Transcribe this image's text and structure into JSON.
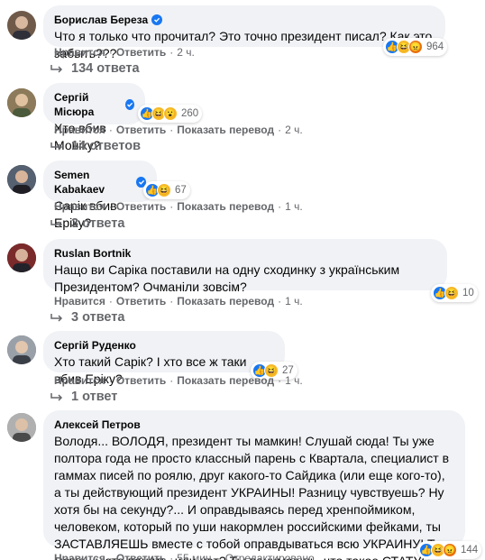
{
  "labels": {
    "like": "Нравится",
    "reply": "Ответить",
    "translate": "Показать перевод",
    "edited": "Отредактировано",
    "sep": "·"
  },
  "comments": [
    {
      "author": "Борислав Береза",
      "verified": true,
      "text": "Что я только что прочитал? Это точно президент писал? Как это забыть???",
      "reactions": [
        "like",
        "haha",
        "angry"
      ],
      "reaction_count": "964",
      "time": "2 ч.",
      "show_translate": false,
      "replies": "134 ответа",
      "avatar_color": "#6f5a4a"
    },
    {
      "author": "Сергій Місюра",
      "verified": true,
      "text": "Хто вбив Моніку?",
      "reactions": [
        "like",
        "haha",
        "wow"
      ],
      "reaction_count": "260",
      "time": "2 ч.",
      "show_translate": true,
      "replies": "14 ответов",
      "avatar_color": "#7a6a52"
    },
    {
      "author": "Semen Kabakaev",
      "verified": true,
      "text": "Сарік вбив Еріку?",
      "reactions": [
        "like",
        "haha"
      ],
      "reaction_count": "67",
      "time": "1 ч.",
      "show_translate": true,
      "replies": "3 ответа",
      "avatar_color": "#3b3f47"
    },
    {
      "author": "Ruslan Bortnik",
      "verified": false,
      "text": "Нащо ви Саріка поставили на одну сходинку з українським Президентом? Очманіли зовсім?",
      "reactions": [
        "like",
        "haha"
      ],
      "reaction_count": "10",
      "time": "1 ч.",
      "show_translate": true,
      "replies": "3 ответа",
      "avatar_color": "#5a2e2e"
    },
    {
      "author": "Сергій Руденко",
      "verified": false,
      "text": "Хто такий Сарік? І хто все ж таки вбив Еріку?",
      "reactions": [
        "like",
        "haha"
      ],
      "reaction_count": "27",
      "time": "1 ч.",
      "show_translate": true,
      "replies": "1 ответ",
      "avatar_color": "#6b6f74"
    },
    {
      "author": "Алексей Петров",
      "verified": false,
      "text": "Володя... ВОЛОДЯ, президент ты мамкин! Слушай сюда! Ты уже полтора года не просто классный парень с Квартала, специалист в гаммах писей по роялю, друг какого-то Сайдика (или еще кого-то), а ты действующий президент УКРАИНЫ! Разницу чувствуешь? Ну хотя бы на секунду?... И оправдываясь перед хренпоймиком, человеком, который по уши накормлен российскими фейками, ты ЗАСТАВЛЯЕШЬ вместе с тобой оправдываться всю УКРАИНУ! Ты можешь это понять, или нет? Ты понимаешь, что такое СТАТУС Верховного Главнокомандующего Украины, или нет?",
      "reactions": [
        "like",
        "haha",
        "angry"
      ],
      "reaction_count": "144",
      "time": "55 мин.",
      "show_translate": false,
      "edited": true,
      "avatar_color": "#8a8a8a"
    }
  ]
}
